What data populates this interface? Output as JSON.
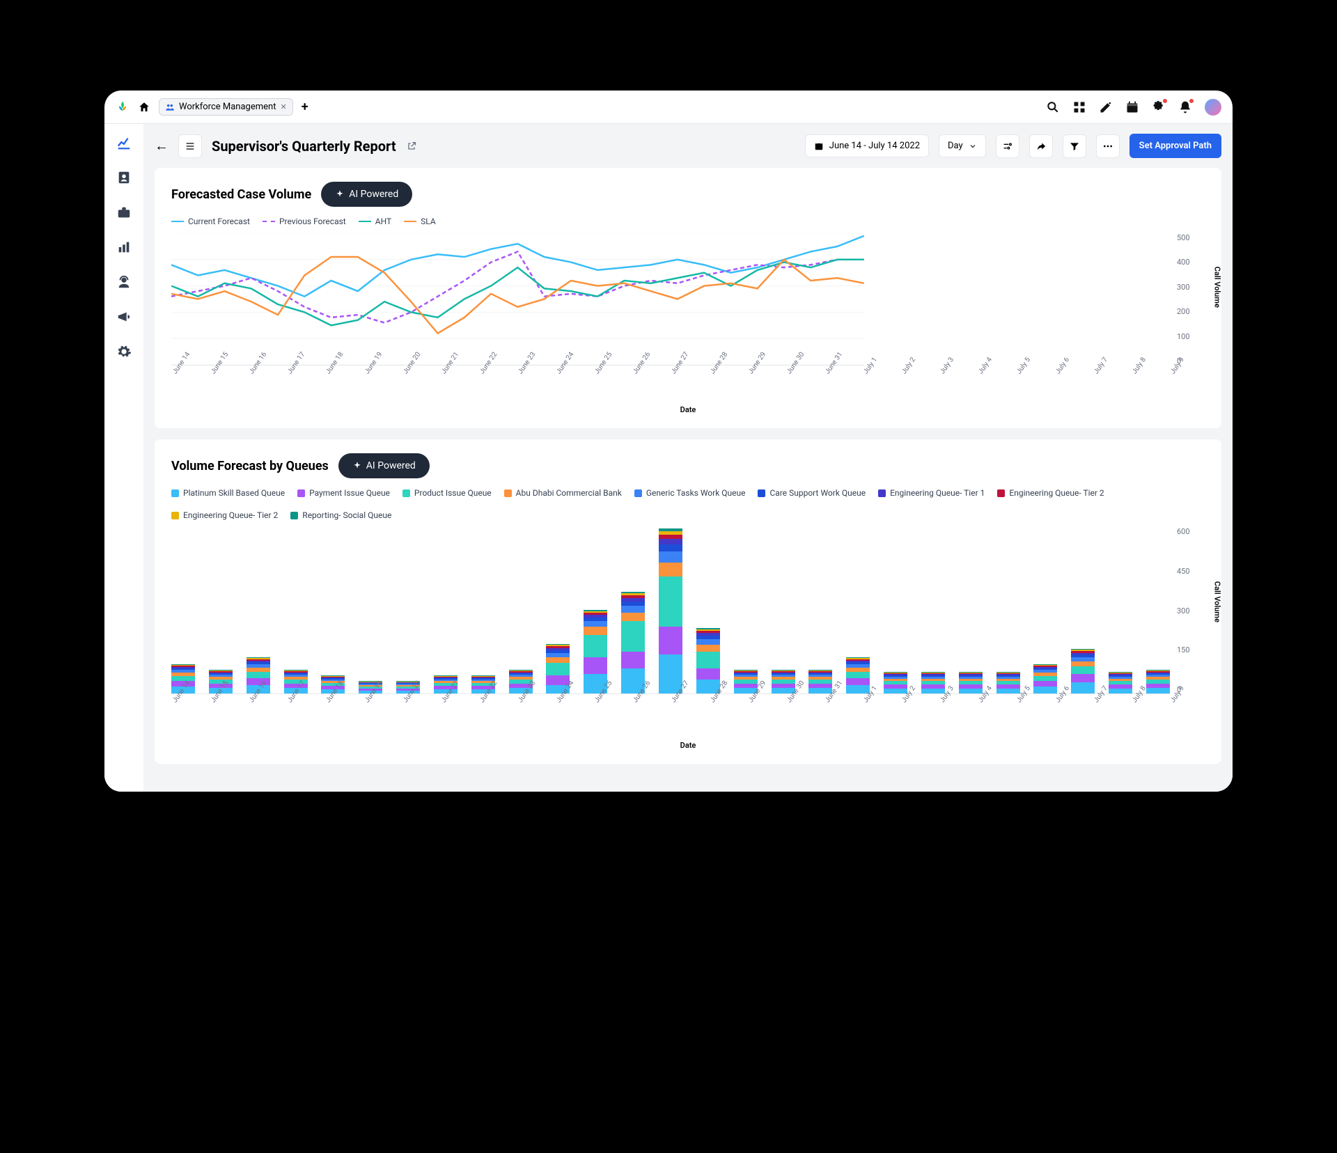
{
  "topbar": {
    "tab_label": "Workforce Management",
    "icons": [
      "search",
      "apps",
      "edit",
      "calendar",
      "puzzle",
      "bell",
      "avatar"
    ]
  },
  "header": {
    "title": "Supervisor's Quarterly Report",
    "date_range": "June 14 - July 14 2022",
    "granularity": "Day",
    "approval_btn": "Set Approval Path"
  },
  "card1": {
    "title": "Forecasted Case Volume",
    "pill": "AI Powered",
    "legend": [
      {
        "label": "Current Forecast",
        "color": "#38bdf8",
        "type": "line"
      },
      {
        "label": "Previous Forecast",
        "color": "#a855f7",
        "type": "dash"
      },
      {
        "label": "AHT",
        "color": "#14b8a6",
        "type": "line"
      },
      {
        "label": "SLA",
        "color": "#fb923c",
        "type": "line"
      }
    ],
    "ylabel": "Call Volume",
    "xlabel": "Date"
  },
  "card2": {
    "title": "Volume Forecast by Queues",
    "pill": "AI Powered",
    "legend": [
      {
        "label": "Platinum Skill Based Queue",
        "color": "#38bdf8"
      },
      {
        "label": "Payment Issue Queue",
        "color": "#a855f7"
      },
      {
        "label": "Product Issue Queue",
        "color": "#2dd4bf"
      },
      {
        "label": "Abu Dhabi Commercial Bank",
        "color": "#fb923c"
      },
      {
        "label": "Generic Tasks Work Queue",
        "color": "#3b82f6"
      },
      {
        "label": "Care Support Work Queue",
        "color": "#1d4ed8"
      },
      {
        "label": "Engineering Queue- Tier 1",
        "color": "#4338ca"
      },
      {
        "label": "Engineering Queue- Tier 2",
        "color": "#be123c"
      },
      {
        "label": "Engineering Queue- Tier 2",
        "color": "#eab308"
      },
      {
        "label": "Reporting- Social Queue",
        "color": "#0d9488"
      }
    ],
    "ylabel": "Call Volume",
    "xlabel": "Date"
  },
  "chart_data": [
    {
      "type": "line",
      "title": "Forecasted Case Volume",
      "xlabel": "Date",
      "ylabel": "Call Volume",
      "ylim": [
        0,
        500
      ],
      "categories": [
        "June 14",
        "June 15",
        "June 16",
        "June 17",
        "June 18",
        "June 19",
        "June 20",
        "June 21",
        "June 22",
        "June 23",
        "June 24",
        "June 25",
        "June 26",
        "June 27",
        "June 28",
        "June 29",
        "June 30",
        "June 31",
        "July 1",
        "July 2",
        "July 3",
        "July 4",
        "July 5",
        "July 6",
        "July 7",
        "July 8",
        "July 9"
      ],
      "y_ticks": [
        500,
        400,
        300,
        200,
        100,
        0
      ],
      "series": [
        {
          "name": "Current Forecast",
          "color": "#38bdf8",
          "style": "solid",
          "values": [
            380,
            340,
            360,
            330,
            300,
            260,
            320,
            280,
            360,
            400,
            420,
            410,
            440,
            460,
            410,
            390,
            360,
            370,
            380,
            400,
            380,
            350,
            370,
            400,
            430,
            450,
            490
          ]
        },
        {
          "name": "Previous Forecast",
          "color": "#a855f7",
          "style": "dash",
          "values": [
            260,
            280,
            300,
            330,
            280,
            220,
            180,
            190,
            160,
            200,
            260,
            320,
            390,
            430,
            260,
            270,
            260,
            300,
            320,
            310,
            340,
            360,
            380,
            370,
            380,
            400,
            400
          ]
        },
        {
          "name": "AHT",
          "color": "#14b8a6",
          "style": "solid",
          "values": [
            300,
            260,
            310,
            290,
            230,
            200,
            150,
            170,
            240,
            200,
            180,
            250,
            300,
            370,
            290,
            280,
            260,
            320,
            310,
            330,
            350,
            300,
            360,
            390,
            370,
            400,
            400
          ]
        },
        {
          "name": "SLA",
          "color": "#fb923c",
          "style": "solid",
          "values": [
            270,
            250,
            280,
            240,
            190,
            340,
            410,
            410,
            350,
            240,
            120,
            180,
            270,
            220,
            250,
            320,
            300,
            310,
            280,
            250,
            300,
            310,
            290,
            400,
            320,
            330,
            310
          ]
        }
      ]
    },
    {
      "type": "bar",
      "stacked": true,
      "title": "Volume Forecast by Queues",
      "xlabel": "Date",
      "ylabel": "Call Volume",
      "ylim": [
        0,
        600
      ],
      "y_ticks": [
        600,
        450,
        300,
        150,
        0
      ],
      "categories": [
        "June 14",
        "June 15",
        "June 16",
        "June 17",
        "June 18",
        "June 19",
        "June 20",
        "June 21",
        "June 22",
        "June 23",
        "June 24",
        "June 25",
        "June 26",
        "June 27",
        "June 28",
        "June 29",
        "June 30",
        "June 31",
        "July 1",
        "July 2",
        "July 3",
        "July 4",
        "July 5",
        "July 6",
        "July 7",
        "July 8",
        "July 9"
      ],
      "series": [
        {
          "name": "Platinum Skill Based Queue",
          "color": "#38bdf8",
          "values": [
            25,
            20,
            30,
            20,
            15,
            10,
            10,
            15,
            15,
            20,
            30,
            70,
            90,
            140,
            50,
            20,
            20,
            20,
            30,
            18,
            18,
            18,
            18,
            25,
            40,
            18,
            20
          ]
        },
        {
          "name": "Payment Issue Queue",
          "color": "#a855f7",
          "values": [
            20,
            15,
            25,
            15,
            12,
            8,
            8,
            12,
            12,
            15,
            35,
            60,
            60,
            100,
            40,
            15,
            15,
            15,
            25,
            14,
            14,
            14,
            14,
            20,
            30,
            14,
            15
          ]
        },
        {
          "name": "Product Issue Queue",
          "color": "#2dd4bf",
          "values": [
            18,
            14,
            22,
            14,
            10,
            7,
            7,
            10,
            10,
            14,
            45,
            80,
            110,
            180,
            60,
            14,
            14,
            14,
            22,
            12,
            12,
            12,
            12,
            18,
            28,
            12,
            14
          ]
        },
        {
          "name": "Abu Dhabi Commercial Bank",
          "color": "#fb923c",
          "values": [
            12,
            10,
            15,
            10,
            8,
            5,
            5,
            8,
            8,
            10,
            20,
            30,
            30,
            50,
            25,
            10,
            10,
            10,
            15,
            9,
            9,
            9,
            9,
            12,
            18,
            9,
            10
          ]
        },
        {
          "name": "Generic Tasks Work Queue",
          "color": "#3b82f6",
          "values": [
            10,
            8,
            12,
            8,
            6,
            4,
            4,
            6,
            6,
            8,
            15,
            20,
            25,
            40,
            20,
            8,
            8,
            8,
            12,
            7,
            7,
            7,
            7,
            10,
            14,
            7,
            8
          ]
        },
        {
          "name": "Care Support Work Queue",
          "color": "#1d4ed8",
          "values": [
            6,
            5,
            8,
            5,
            4,
            3,
            3,
            4,
            4,
            5,
            10,
            12,
            15,
            25,
            12,
            5,
            5,
            5,
            8,
            5,
            5,
            5,
            5,
            6,
            9,
            5,
            5
          ]
        },
        {
          "name": "Engineering Queue- Tier 1",
          "color": "#4338ca",
          "values": [
            5,
            4,
            6,
            4,
            3,
            2,
            2,
            3,
            3,
            4,
            8,
            10,
            12,
            20,
            10,
            4,
            4,
            4,
            6,
            4,
            4,
            4,
            4,
            5,
            7,
            4,
            4
          ]
        },
        {
          "name": "Engineering Queue- Tier 2",
          "color": "#be123c",
          "values": [
            4,
            3,
            5,
            3,
            3,
            2,
            2,
            3,
            3,
            3,
            6,
            8,
            10,
            15,
            8,
            3,
            3,
            3,
            5,
            3,
            3,
            3,
            3,
            4,
            6,
            3,
            3
          ]
        },
        {
          "name": "Engineering Queue- Tier 2 (b)",
          "color": "#eab308",
          "values": [
            3,
            3,
            4,
            3,
            2,
            2,
            2,
            2,
            2,
            3,
            5,
            6,
            8,
            12,
            6,
            3,
            3,
            3,
            4,
            3,
            3,
            3,
            3,
            3,
            5,
            3,
            3
          ]
        },
        {
          "name": "Reporting- Social Queue",
          "color": "#0d9488",
          "values": [
            3,
            2,
            4,
            2,
            2,
            1,
            1,
            2,
            2,
            2,
            4,
            5,
            6,
            10,
            5,
            2,
            2,
            2,
            4,
            2,
            2,
            2,
            2,
            3,
            4,
            2,
            2
          ]
        }
      ]
    }
  ]
}
